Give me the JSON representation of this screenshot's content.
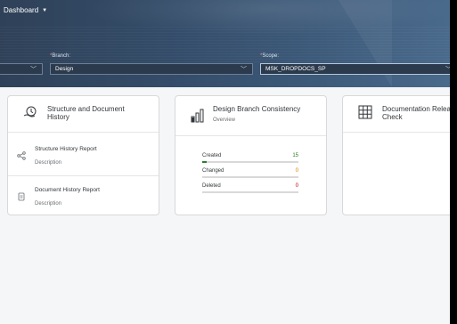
{
  "header": {
    "title": "Dashboard"
  },
  "filters": [
    {
      "label": "",
      "value": ""
    },
    {
      "label": "Branch:",
      "required": true,
      "value": "Design"
    },
    {
      "label": "Scope:",
      "required": true,
      "value": "MSK_DROPDOCS_SP"
    }
  ],
  "cards": [
    {
      "title_line1": "Structure and Document",
      "title_line2": "History",
      "items": [
        {
          "title": "Structure History Report",
          "desc": "Description"
        },
        {
          "title": "Document History Report",
          "desc": "Description"
        }
      ]
    },
    {
      "title": "Design Branch Consistency",
      "subtitle": "Overview",
      "rows": [
        {
          "label": "Created",
          "value": "15",
          "color": "#2b7d2b",
          "fill": 0.2
        },
        {
          "label": "Changed",
          "value": "0",
          "color": "#e07700",
          "fill": 0
        },
        {
          "label": "Deleted",
          "value": "0",
          "color": "#bb0000",
          "fill": 0
        }
      ]
    },
    {
      "title_line1": "Documentation Relea",
      "title_line2": "Check"
    }
  ]
}
